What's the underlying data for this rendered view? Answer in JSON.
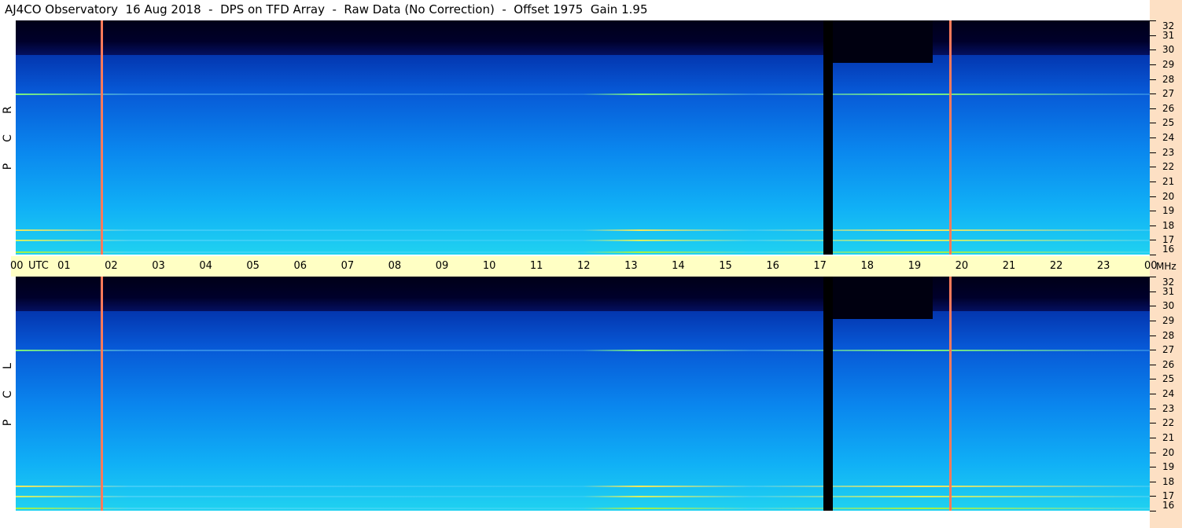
{
  "title": "AJ4CO Observatory  16 Aug 2018  -  DPS on TFD Array  -  Raw Data (No Correction)  -  Offset 1975  Gain 1.95",
  "panels": [
    {
      "id": "rcp",
      "label": [
        "R",
        "C",
        "P"
      ]
    },
    {
      "id": "lcp",
      "label": [
        "L",
        "C",
        "P"
      ]
    }
  ],
  "time_axis": {
    "ticks": [
      "00",
      "01",
      "02",
      "03",
      "04",
      "05",
      "06",
      "07",
      "08",
      "09",
      "10",
      "11",
      "12",
      "13",
      "14",
      "15",
      "16",
      "17",
      "18",
      "19",
      "20",
      "21",
      "22",
      "23",
      "00"
    ],
    "utc_label": "UTC",
    "mhz_label": "MHz"
  },
  "freq_axis": {
    "ticks": [
      "32",
      "31",
      "30",
      "29",
      "28",
      "27",
      "26",
      "25",
      "24",
      "23",
      "22",
      "21",
      "20",
      "19",
      "18",
      "17",
      "16"
    ]
  },
  "colors": {
    "vertical_line_left": "#ff7a5a",
    "vertical_line_right": "#ff7a5a",
    "dropout": "#000000"
  },
  "chart_data": {
    "type": "heatmap",
    "title": "AJ4CO Observatory  16 Aug 2018  -  DPS on TFD Array  -  Raw Data (No Correction)  -  Offset 1975  Gain 1.95",
    "x_unit": "UTC",
    "xlim": [
      "00",
      "00"
    ],
    "y_unit": "MHz",
    "ylim": [
      16,
      32
    ],
    "series": [
      {
        "name": "RCP"
      },
      {
        "name": "LCP"
      }
    ],
    "features": {
      "dropout_hours_utc": [
        17.1,
        17.3
      ],
      "vertical_lines_utc": [
        1.8,
        19.75
      ],
      "persistent_bands_mhz": [
        27.0,
        17.7,
        17.0,
        16.2
      ]
    }
  }
}
